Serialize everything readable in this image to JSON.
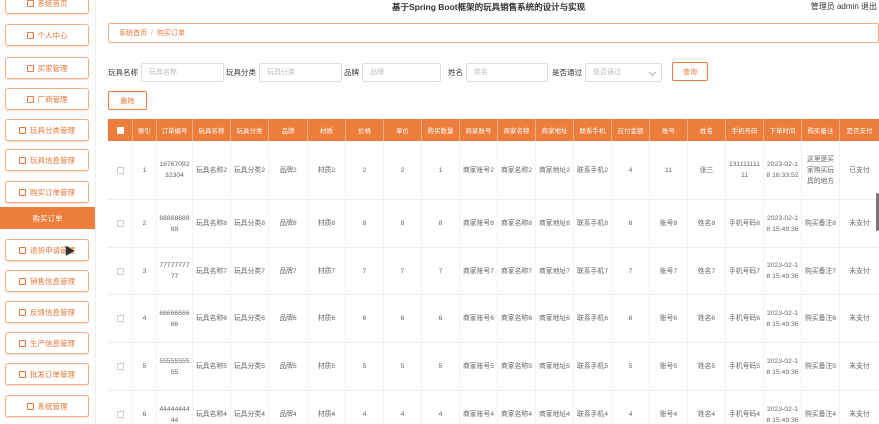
{
  "app_title": "基于Spring Boot框架的玩具销售系统的设计与实现",
  "user_info": "管理员 admin  退出",
  "sidebar": {
    "items": [
      {
        "label": "系统首页",
        "icon": "home-icon"
      },
      {
        "label": "个人中心",
        "icon": "user-icon"
      },
      {
        "label": "买家管理",
        "icon": "grid-icon"
      },
      {
        "label": "厂商管理",
        "icon": "factory-icon"
      },
      {
        "label": "玩具分类管理",
        "icon": "chart-icon"
      },
      {
        "label": "玩具信息管理",
        "icon": "box-icon"
      },
      {
        "label": "购买订单管理",
        "icon": "grid-icon"
      },
      {
        "label": "购买订单",
        "icon": ""
      },
      {
        "label": "退货申请管理",
        "icon": "box-icon"
      },
      {
        "label": "销售信息管理",
        "icon": "grid-icon"
      },
      {
        "label": "反馈信息管理",
        "icon": "box-icon"
      },
      {
        "label": "生产信息管理",
        "icon": "gear-icon"
      },
      {
        "label": "批发订单管理",
        "icon": "grid-icon"
      },
      {
        "label": "系统管理",
        "icon": "grid-icon"
      }
    ]
  },
  "breadcrumb": {
    "home": "系统首页",
    "separator": "/",
    "current": "购买订单"
  },
  "search": {
    "toy_name_label": "玩具名称",
    "toy_name_placeholder": "玩具名称",
    "toy_category_label": "玩具分类",
    "toy_category_placeholder": "玩具分类",
    "brand_label": "品牌",
    "brand_placeholder": "品牌",
    "name_label": "姓名",
    "name_placeholder": "姓名",
    "approved_label": "是否通过",
    "approved_placeholder": "是否通过",
    "search_button": "查询"
  },
  "actions": {
    "delete_button": "删除"
  },
  "table": {
    "headers": [
      "",
      "索引",
      "订单编号",
      "玩具名称",
      "玩具分类",
      "品牌",
      "材质",
      "价格",
      "单价",
      "购买数量",
      "商家账号",
      "商家名称",
      "商家地址",
      "联系手机",
      "应付金额",
      "账号",
      "姓名",
      "手机号码",
      "下单时间",
      "购买备注",
      "是否支付"
    ],
    "rows": [
      [
        "",
        "1",
        "1676709232304",
        "玩具名称2",
        "玩具分类2",
        "品牌2",
        "材质2",
        "2",
        "2",
        "1",
        "商家账号2",
        "商家名称2",
        "商家地址2",
        "联系手机2",
        "4",
        "11",
        "张三",
        "13111111111",
        "2023-02-18 16:33:52",
        "这里是买家购买玩具的地方",
        "已支付"
      ],
      [
        "",
        "2",
        "8888888888",
        "玩具名称8",
        "玩具分类8",
        "品牌8",
        "材质8",
        "8",
        "8",
        "8",
        "商家账号8",
        "商家名称8",
        "商家地址8",
        "联系手机8",
        "8",
        "账号8",
        "姓名8",
        "手机号码8",
        "2023-02-18 15:49:36",
        "购买备注8",
        "未支付"
      ],
      [
        "",
        "3",
        "7777777777",
        "玩具名称7",
        "玩具分类7",
        "品牌7",
        "材质7",
        "7",
        "7",
        "7",
        "商家账号7",
        "商家名称7",
        "商家地址7",
        "联系手机7",
        "7",
        "账号7",
        "姓名7",
        "手机号码7",
        "2023-02-18 15:49:36",
        "购买备注7",
        "未支付"
      ],
      [
        "",
        "4",
        "6666666666",
        "玩具名称6",
        "玩具分类6",
        "品牌6",
        "材质6",
        "6",
        "6",
        "6",
        "商家账号6",
        "商家名称6",
        "商家地址6",
        "联系手机6",
        "6",
        "账号6",
        "姓名6",
        "手机号码6",
        "2023-02-18 15:49:36",
        "购买备注6",
        "未支付"
      ],
      [
        "",
        "5",
        "5555555555",
        "玩具名称5",
        "玩具分类5",
        "品牌5",
        "材质5",
        "5",
        "5",
        "5",
        "商家账号5",
        "商家名称5",
        "商家地址5",
        "联系手机5",
        "5",
        "账号5",
        "姓名5",
        "手机号码5",
        "2023-02-18 15:49:36",
        "购买备注5",
        "未支付"
      ],
      [
        "",
        "6",
        "4444444444",
        "玩具名称4",
        "玩具分类4",
        "品牌4",
        "材质4",
        "4",
        "4",
        "4",
        "商家账号4",
        "商家名称4",
        "商家地址4",
        "联系手机4",
        "4",
        "账号4",
        "姓名4",
        "手机号码4",
        "2023-02-18 15:49:36",
        "购买备注4",
        "未支付"
      ]
    ]
  },
  "colors": {
    "accent": "#ec7d3b",
    "accent_border": "#f0b089"
  }
}
